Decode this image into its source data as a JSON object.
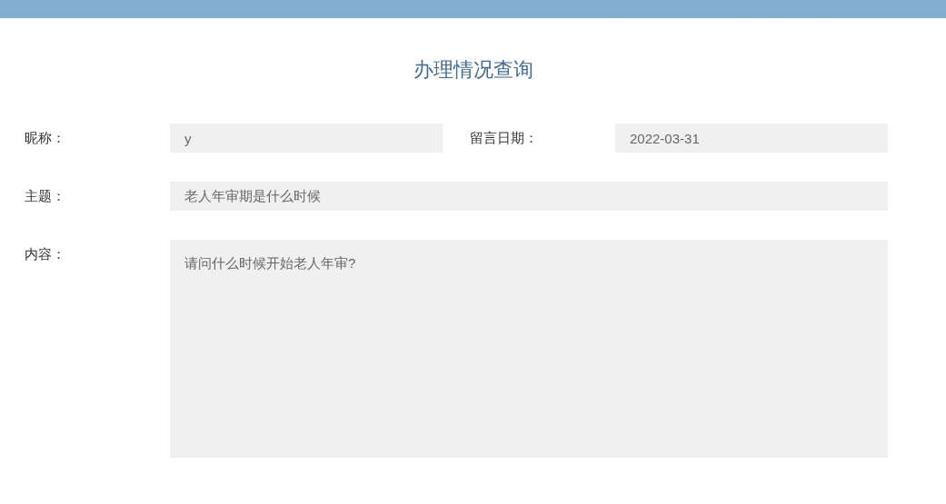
{
  "title": "办理情况查询",
  "fields": [
    {
      "label": "昵称：",
      "value": "y",
      "kind": "short"
    },
    {
      "label": "留言日期：",
      "value": "2022-03-31",
      "kind": "short"
    },
    {
      "label": "主题：",
      "value": "老人年审期是什么时候",
      "kind": "wide"
    },
    {
      "label": "内容：",
      "value": "请问什么时候开始老人年审?",
      "kind": "area"
    }
  ]
}
